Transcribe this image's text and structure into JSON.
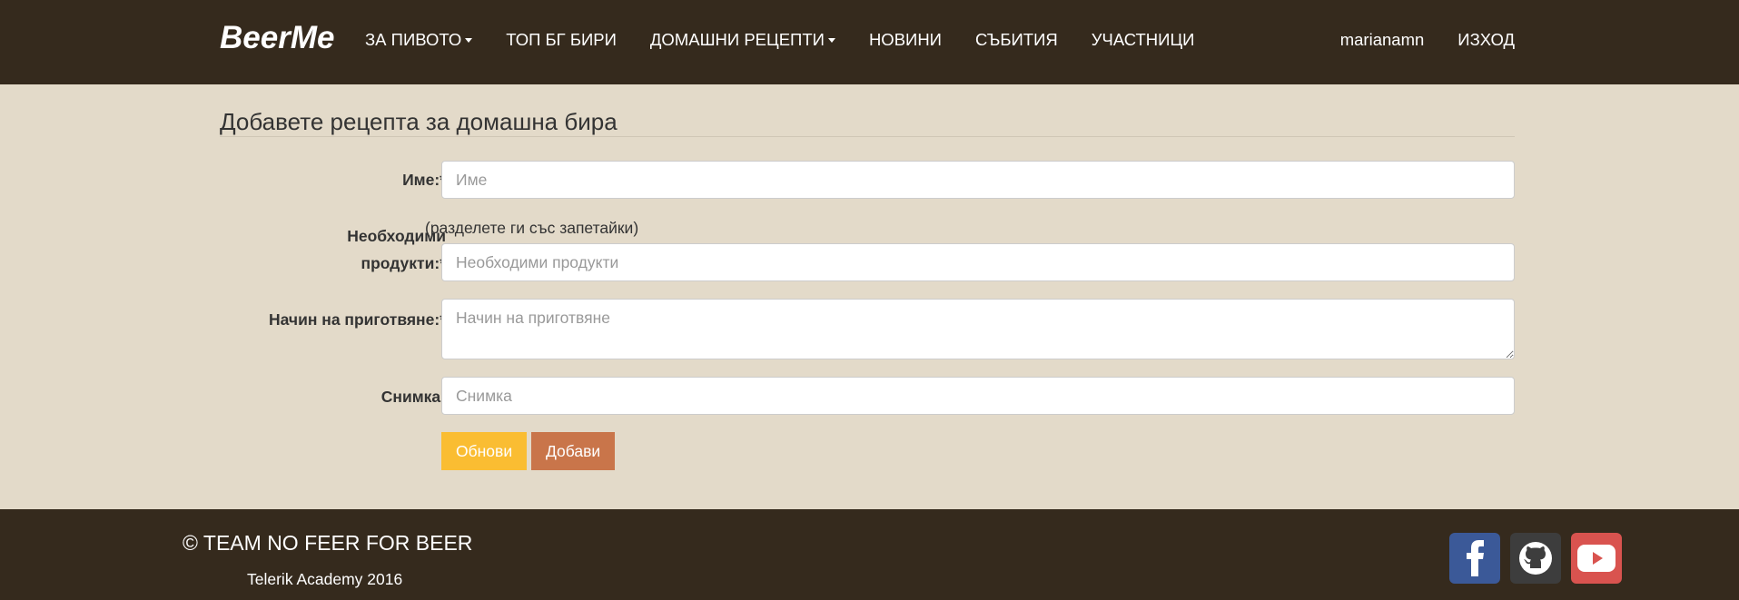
{
  "navbar": {
    "brand": "BeerMe",
    "links": [
      {
        "label": "ЗА ПИВОТО",
        "dropdown": true
      },
      {
        "label": "ТОП БГ БИРИ",
        "dropdown": false
      },
      {
        "label": "ДОМАШНИ РЕЦЕПТИ",
        "dropdown": true
      },
      {
        "label": "НОВИНИ",
        "dropdown": false
      },
      {
        "label": "СЪБИТИЯ",
        "dropdown": false
      },
      {
        "label": "УЧАСТНИЦИ",
        "dropdown": false
      }
    ],
    "user": "marianamn",
    "logout": "ИЗХОД"
  },
  "form": {
    "title": "Добавете рецепта за домашна бира",
    "name": {
      "label": "Име:*",
      "placeholder": "Име"
    },
    "ingredients": {
      "label_line1": "Необходими",
      "label_line2": "продукти:*",
      "help": "(разделете ги със запетайки)",
      "placeholder": "Необходими продукти"
    },
    "preparation": {
      "label": "Начин на приготвяне:*",
      "placeholder": "Начин на приготвяне"
    },
    "image": {
      "label": "Снимка:",
      "placeholder": "Снимка"
    },
    "update_button": "Обнови",
    "add_button": "Добави"
  },
  "footer": {
    "copyright": "© TEAM NO FEER FOR BEER",
    "academy": "Telerik Academy 2016",
    "social": [
      {
        "icon": "facebook-icon",
        "color": "#3b5998"
      },
      {
        "icon": "github-icon",
        "color": "#3d3d3d"
      },
      {
        "icon": "youtube-icon",
        "color": "#d9534f"
      }
    ]
  },
  "colors": {
    "navbar_bg": "#352a1d",
    "page_bg": "#e3dac9",
    "update_button": "#fabd32",
    "add_button": "#c9754a"
  }
}
